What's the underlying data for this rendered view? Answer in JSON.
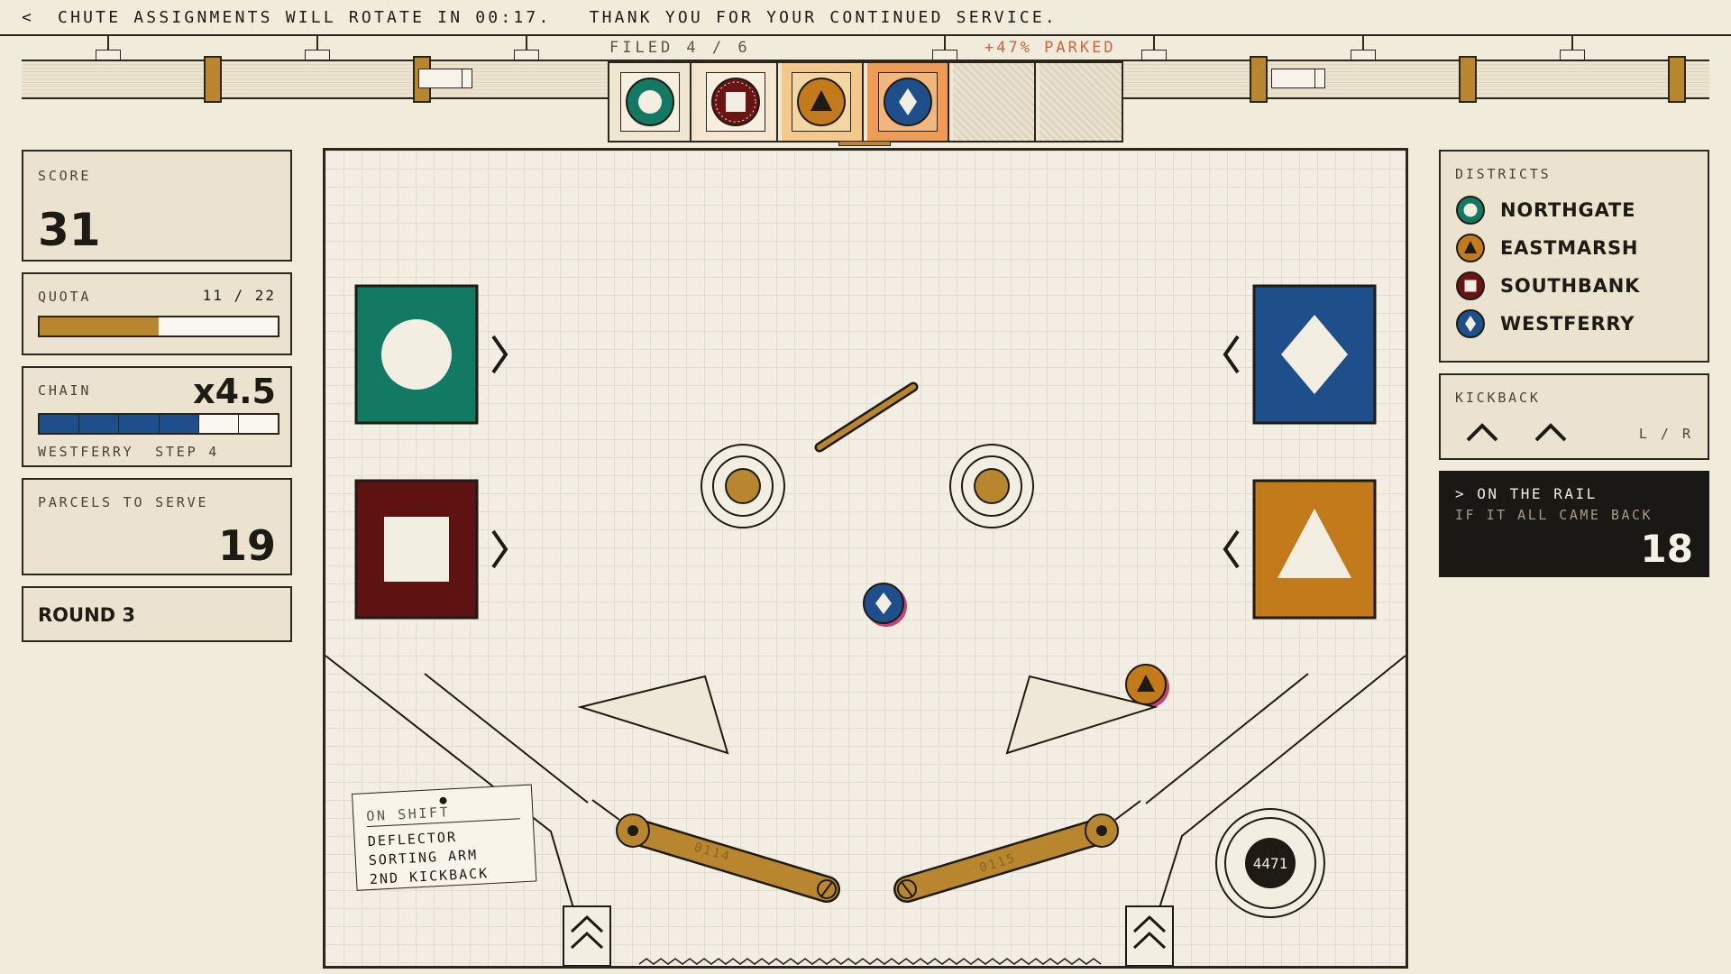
{
  "ticker": {
    "back_glyph": "<",
    "message": "CHUTE ASSIGNMENTS WILL ROTATE IN 00:17.   THANK YOU FOR YOUR CONTINUED SERVICE."
  },
  "tray": {
    "filed_label": "FILED 4 / 6",
    "parked_label": "+47% PARKED",
    "slots": [
      {
        "district": "northgate",
        "icon": "ring-icon"
      },
      {
        "district": "southbank",
        "icon": "square-icon"
      },
      {
        "district": "eastmarsh",
        "icon": "triangle-icon"
      },
      {
        "district": "westferry",
        "icon": "diamond-icon"
      },
      {
        "district": "",
        "icon": ""
      },
      {
        "district": "",
        "icon": ""
      }
    ]
  },
  "score": {
    "label": "SCORE",
    "value": "31"
  },
  "quota": {
    "label": "QUOTA",
    "count": "11 / 22",
    "fraction": 0.5
  },
  "chain": {
    "label": "CHAIN",
    "multiplier": "x4.5",
    "segments_total": 6,
    "segments_on": 4,
    "step_text": "WESTFERRY  STEP 4"
  },
  "parcels": {
    "label": "PARCELS TO SERVE",
    "value": "19"
  },
  "round": {
    "label": "ROUND 3"
  },
  "districts": {
    "label": "DISTRICTS",
    "items": [
      {
        "name": "NORTHGATE",
        "icon": "ring-icon",
        "color": "#127a62"
      },
      {
        "name": "EASTMARSH",
        "icon": "triangle-icon",
        "color": "#c27a1a"
      },
      {
        "name": "SOUTHBANK",
        "icon": "square-icon",
        "color": "#6b1414"
      },
      {
        "name": "WESTFERRY",
        "icon": "diamond-icon",
        "color": "#1f4f8a"
      }
    ]
  },
  "kickback": {
    "label": "KICKBACK",
    "lr": "L / R"
  },
  "on_rail": {
    "heading": "> ON THE RAIL",
    "sub": "IF IT ALL CAME BACK",
    "value": "18"
  },
  "field": {
    "note": {
      "heading": "ON SHIFT",
      "lines": [
        "DEFLECTOR",
        "SORTING ARM",
        "2ND KICKBACK"
      ]
    },
    "flipper_left_id": "0114",
    "flipper_right_id": "0115",
    "counter": "4471"
  },
  "colors": {
    "northgate": "#127a62",
    "eastmarsh": "#c27a1a",
    "southbank": "#6b1414",
    "westferry": "#1f4f8a",
    "brass": "#b8862f",
    "ink": "#2a251d"
  }
}
